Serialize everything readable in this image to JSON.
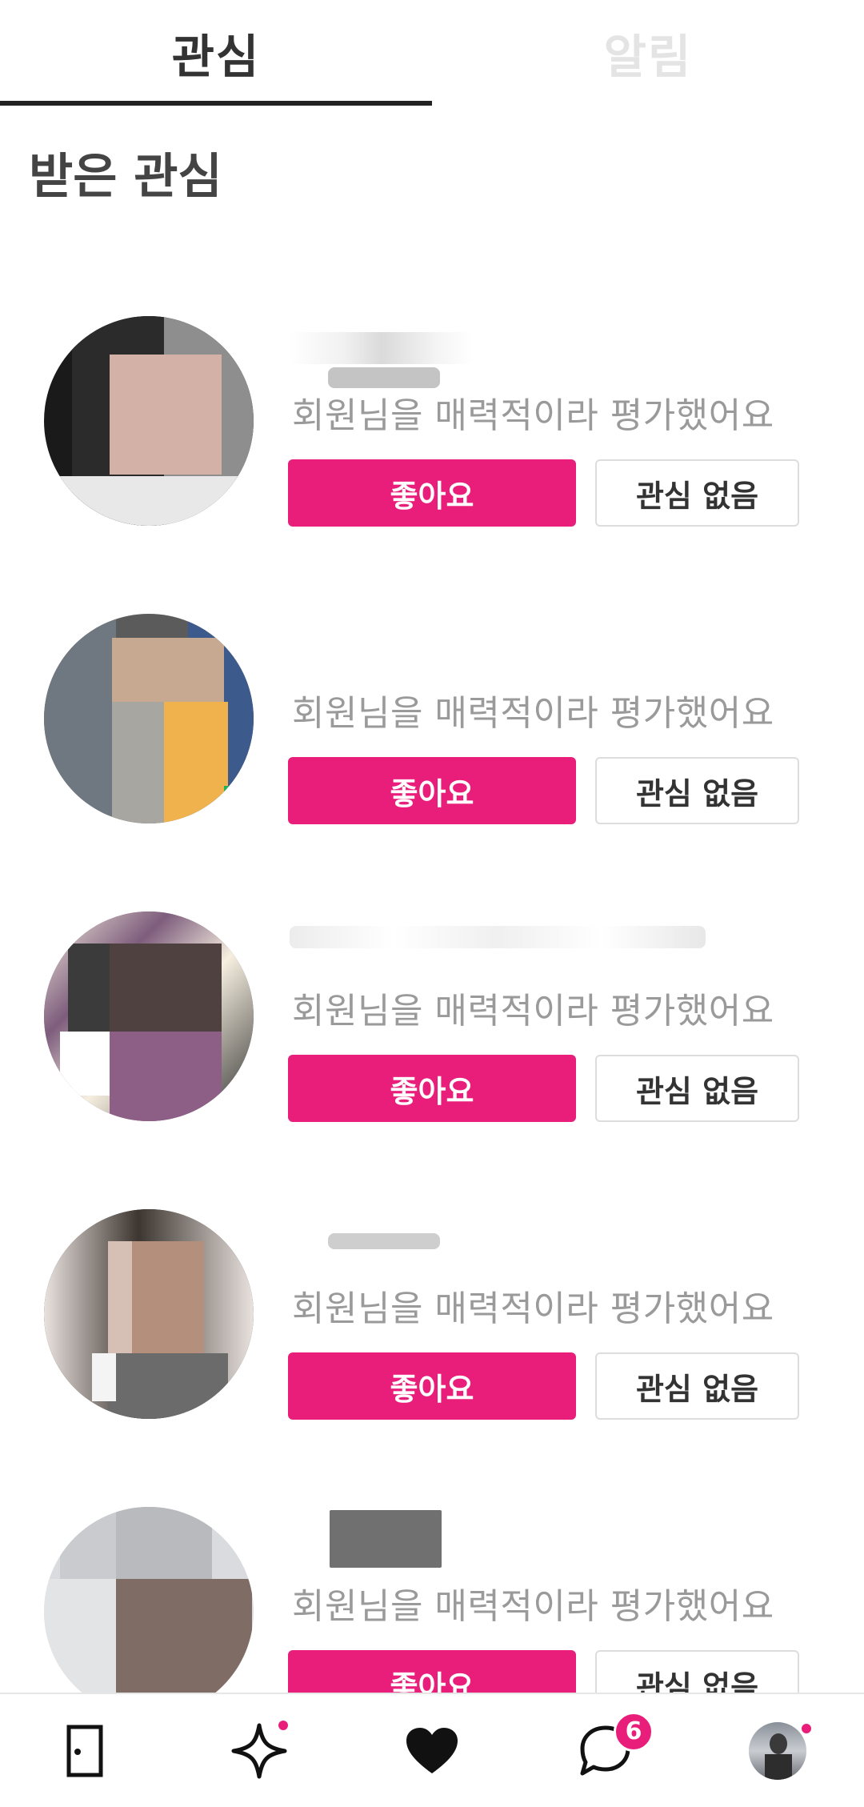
{
  "tabs": [
    {
      "label": "관심",
      "active": true
    },
    {
      "label": "알림",
      "active": false
    }
  ],
  "section_title": "받은 관심",
  "entries": [
    {
      "message": "회원님을 매력적이라 평가했어요",
      "like_label": "좋아요",
      "pass_label": "관심 없음"
    },
    {
      "message": "회원님을 매력적이라 평가했어요",
      "like_label": "좋아요",
      "pass_label": "관심 없음"
    },
    {
      "message": "회원님을 매력적이라 평가했어요",
      "like_label": "좋아요",
      "pass_label": "관심 없음"
    },
    {
      "message": "회원님을 매력적이라 평가했어요",
      "like_label": "좋아요",
      "pass_label": "관심 없음"
    },
    {
      "message": "회원님을 매력적이라 평가했어요",
      "like_label": "좋아요",
      "pass_label": "관심 없음"
    }
  ],
  "bottom_nav": {
    "items": [
      {
        "icon": "door-icon"
      },
      {
        "icon": "sparkle-icon",
        "dot": true
      },
      {
        "icon": "heart-icon"
      },
      {
        "icon": "chat-bubble-icon",
        "badge": "6"
      },
      {
        "icon": "profile-avatar",
        "dot": true
      }
    ]
  },
  "colors": {
    "accent": "#e91e7a",
    "text": "#333333",
    "muted": "#9a9a9a"
  }
}
